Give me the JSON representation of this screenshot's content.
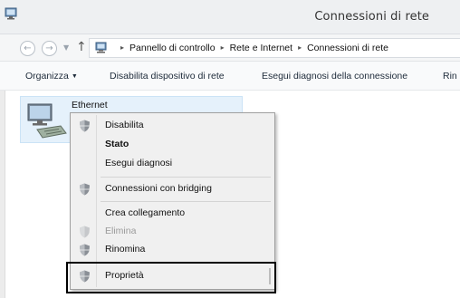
{
  "window": {
    "title": "Connessioni di rete",
    "app_icon": "network-connections-icon"
  },
  "nav": {
    "back_icon": "back-arrow-icon",
    "forward_icon": "forward-arrow-icon",
    "recent_icon": "chevron-down-icon",
    "up_icon": "up-arrow-icon",
    "breadcrumbs": [
      "Pannello di controllo",
      "Rete e Internet",
      "Connessioni di rete"
    ],
    "separator": "▸"
  },
  "toolbar": {
    "organizza": "Organizza",
    "disabilita": "Disabilita dispositivo di rete",
    "diagnosi": "Esegui diagnosi della connessione",
    "rin": "Rin"
  },
  "adapter": {
    "name": "Ethernet",
    "icon": "network-adapter-icon"
  },
  "context_menu": {
    "items": [
      {
        "label": "Disabilita",
        "icon": "uac-shield-icon",
        "bold": false,
        "disabled": false
      },
      {
        "label": "Stato",
        "icon": "",
        "bold": true,
        "disabled": false
      },
      {
        "label": "Esegui diagnosi",
        "icon": "",
        "bold": false,
        "disabled": false
      },
      {
        "label": "Connessioni con bridging",
        "icon": "uac-shield-icon",
        "bold": false,
        "disabled": false
      },
      {
        "label": "Crea collegamento",
        "icon": "",
        "bold": false,
        "disabled": false
      },
      {
        "label": "Elimina",
        "icon": "uac-shield-icon",
        "bold": false,
        "disabled": true
      },
      {
        "label": "Rinomina",
        "icon": "uac-shield-icon",
        "bold": false,
        "disabled": false
      },
      {
        "label": "Proprietà",
        "icon": "uac-shield-icon",
        "bold": false,
        "disabled": false
      }
    ]
  },
  "colors": {
    "selection_bg": "#e5f1fb",
    "menu_bg": "#f0f0f0",
    "highlight_border": "#000000"
  }
}
